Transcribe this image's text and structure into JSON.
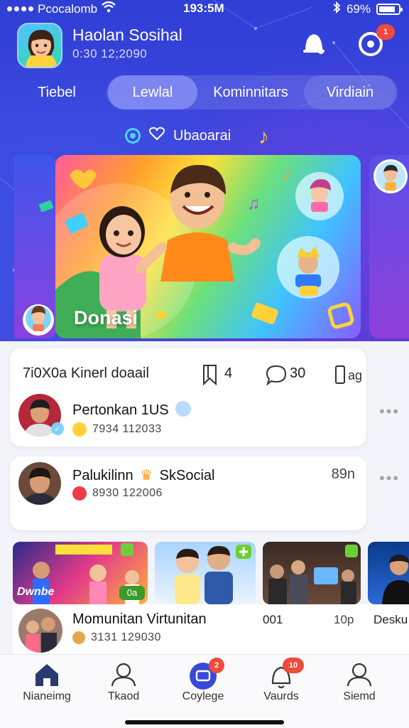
{
  "status_bar": {
    "carrier": "Pcocalomb",
    "time": "193:5M",
    "battery": "69%"
  },
  "header": {
    "title": "Haolan Sosihal",
    "subtitle": "0:30 12;2090",
    "notification_count": "1"
  },
  "tabs": [
    {
      "label": "Tiebel"
    },
    {
      "label": "Lewlal"
    },
    {
      "label": "Kominnitars"
    },
    {
      "label": "Virdiain"
    }
  ],
  "section": {
    "label": "Ubaoarai"
  },
  "hero": {
    "label": "Donasi"
  },
  "post_card": {
    "meta_label": "7i0X0a Kinerl doaail",
    "count_a": "4",
    "count_b": "30",
    "user1": {
      "name": "Pertonkan 1US",
      "detail": "7934 112033"
    }
  },
  "post_card2": {
    "name": "Palukilinn",
    "name_suffix": "SkSocial",
    "detail": "8930 122006",
    "time": "89n"
  },
  "thumbnails": [
    {
      "label": "Dwnbe",
      "tag": "0a"
    },
    {
      "label": ""
    },
    {
      "label": ""
    },
    {
      "label": ""
    }
  ],
  "bottom_row": {
    "title": "Momunitan Virtunitan",
    "detail": "3131 129030",
    "mid": "001",
    "time": "10p",
    "right": "Desku"
  },
  "nav": [
    {
      "label": "Nianeimg"
    },
    {
      "label": "Tkaod"
    },
    {
      "label": "Coylege",
      "badge": "2"
    },
    {
      "label": "Vaurds",
      "badge": "10"
    },
    {
      "label": "Siemd"
    }
  ],
  "colors": {
    "accent": "#3c46dc",
    "badge": "#f04a3a"
  }
}
